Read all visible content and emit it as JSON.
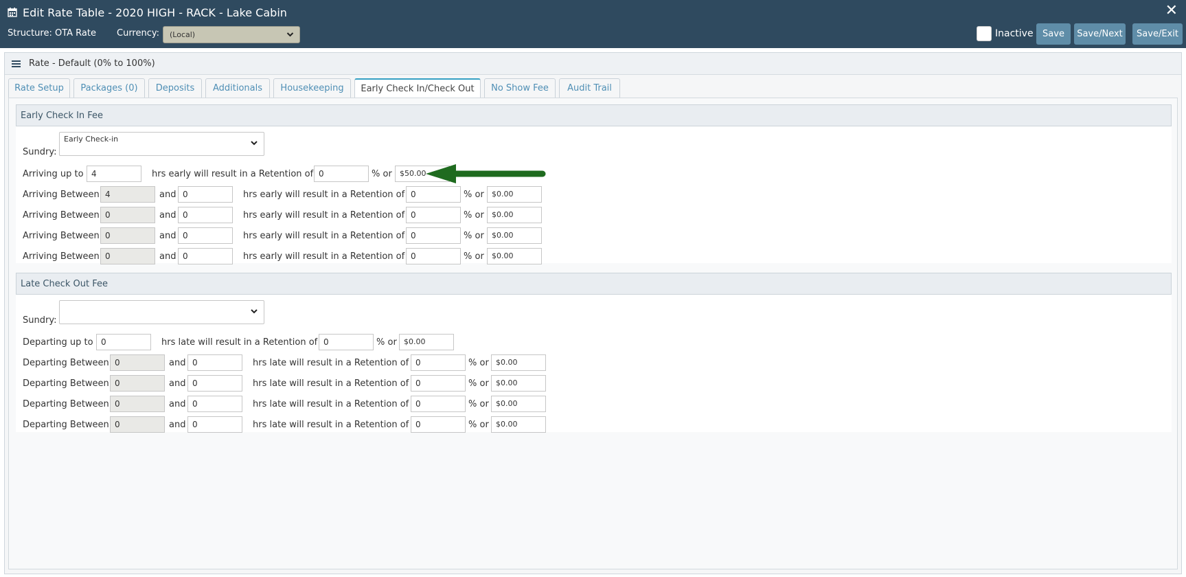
{
  "window": {
    "title": "Edit Rate Table - 2020 HIGH - RACK - Lake Cabin",
    "close_label": "✕"
  },
  "toolbar": {
    "structure": "Structure: OTA Rate",
    "currency_label": "Currency:",
    "currency_value": "(Local)",
    "inactive_label": "Inactive",
    "save_label": "Save",
    "save_next_label": "Save/Next",
    "save_exit_label": "Save/Exit"
  },
  "rate": {
    "title": "Rate - Default (0% to 100%)"
  },
  "tabs": [
    {
      "label": "Rate Setup"
    },
    {
      "label": "Packages (0)"
    },
    {
      "label": "Deposits"
    },
    {
      "label": "Additionals"
    },
    {
      "label": "Housekeeping"
    },
    {
      "label": "Early Check In/Check Out",
      "active": true
    },
    {
      "label": "No Show Fee"
    },
    {
      "label": "Audit Trail"
    }
  ],
  "early": {
    "heading": "Early Check In Fee",
    "sundry_label": "Sundry:",
    "sundry_value": "Early Check-in",
    "first": {
      "prefix": "Arriving up to",
      "hours": "4",
      "middle": "hrs early will result in a Retention of",
      "percent": "0",
      "or": "% or",
      "amount": "$50.00"
    },
    "between_label": "Arriving Between",
    "and_label": "and",
    "middle": "hrs early will result in a Retention of",
    "or": "% or",
    "rows": [
      {
        "from": "4",
        "to": "0",
        "percent": "0",
        "amount": "$0.00"
      },
      {
        "from": "0",
        "to": "0",
        "percent": "0",
        "amount": "$0.00"
      },
      {
        "from": "0",
        "to": "0",
        "percent": "0",
        "amount": "$0.00"
      },
      {
        "from": "0",
        "to": "0",
        "percent": "0",
        "amount": "$0.00"
      }
    ]
  },
  "late": {
    "heading": "Late Check Out Fee",
    "sundry_label": "Sundry:",
    "sundry_value": "",
    "first": {
      "prefix": "Departing up to",
      "hours": "0",
      "middle": "hrs late will result in a Retention of",
      "percent": "0",
      "or": "% or",
      "amount": "$0.00"
    },
    "between_label": "Departing Between",
    "and_label": "and",
    "middle": "hrs late will result in a Retention of",
    "or": "% or",
    "rows": [
      {
        "from": "0",
        "to": "0",
        "percent": "0",
        "amount": "$0.00"
      },
      {
        "from": "0",
        "to": "0",
        "percent": "0",
        "amount": "$0.00"
      },
      {
        "from": "0",
        "to": "0",
        "percent": "0",
        "amount": "$0.00"
      },
      {
        "from": "0",
        "to": "0",
        "percent": "0",
        "amount": "$0.00"
      }
    ]
  },
  "colors": {
    "header_bg": "#2f4a5f",
    "button_bg": "#5f8da8",
    "tab_link": "#4f8fb5",
    "arrow": "#1f6b1f"
  }
}
